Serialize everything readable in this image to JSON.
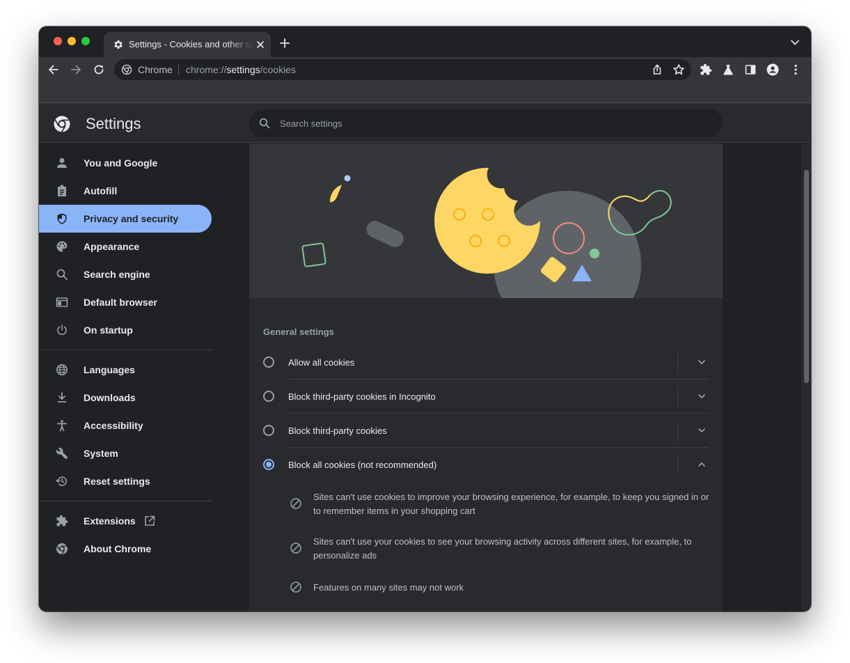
{
  "browser": {
    "tab": {
      "title": "Settings - Cookies and other site data"
    },
    "omnibox": {
      "chip": "Chrome",
      "url_scheme": "chrome://",
      "url_host": "settings",
      "url_path": "/cookies"
    }
  },
  "settings": {
    "title": "Settings",
    "search": {
      "placeholder": "Search settings"
    },
    "sidebar": {
      "items": [
        {
          "label": "You and Google",
          "icon": "person-icon"
        },
        {
          "label": "Autofill",
          "icon": "clipboard-icon"
        },
        {
          "label": "Privacy and security",
          "icon": "shield-icon",
          "active": true
        },
        {
          "label": "Appearance",
          "icon": "palette-icon"
        },
        {
          "label": "Search engine",
          "icon": "search-icon"
        },
        {
          "label": "Default browser",
          "icon": "browser-window-icon"
        },
        {
          "label": "On startup",
          "icon": "power-icon"
        }
      ],
      "advanced": [
        {
          "label": "Languages",
          "icon": "globe-icon"
        },
        {
          "label": "Downloads",
          "icon": "download-icon"
        },
        {
          "label": "Accessibility",
          "icon": "accessibility-icon"
        },
        {
          "label": "System",
          "icon": "wrench-icon"
        },
        {
          "label": "Reset settings",
          "icon": "history-icon"
        }
      ],
      "footer": [
        {
          "label": "Extensions",
          "icon": "puzzle-icon"
        },
        {
          "label": "About Chrome",
          "icon": "chrome-logo-icon"
        }
      ]
    },
    "cookies": {
      "section_title": "General settings",
      "options": [
        {
          "label": "Allow all cookies",
          "selected": false,
          "expanded": false
        },
        {
          "label": "Block third-party cookies in Incognito",
          "selected": false,
          "expanded": false
        },
        {
          "label": "Block third-party cookies",
          "selected": false,
          "expanded": false
        },
        {
          "label": "Block all cookies (not recommended)",
          "selected": true,
          "expanded": true
        }
      ],
      "details": [
        "Sites can't use cookies to improve your browsing experience, for example, to keep you signed in or to remember items in your shopping cart",
        "Sites can't use your cookies to see your browsing activity across different sites, for example, to personalize ads",
        "Features on many sites may not work"
      ]
    }
  },
  "colors": {
    "accent": "#8ab4f8",
    "page_bg": "#202124",
    "card_bg": "#292a2d",
    "text": "#e8eaed",
    "secondary_text": "#9aa0a6"
  }
}
